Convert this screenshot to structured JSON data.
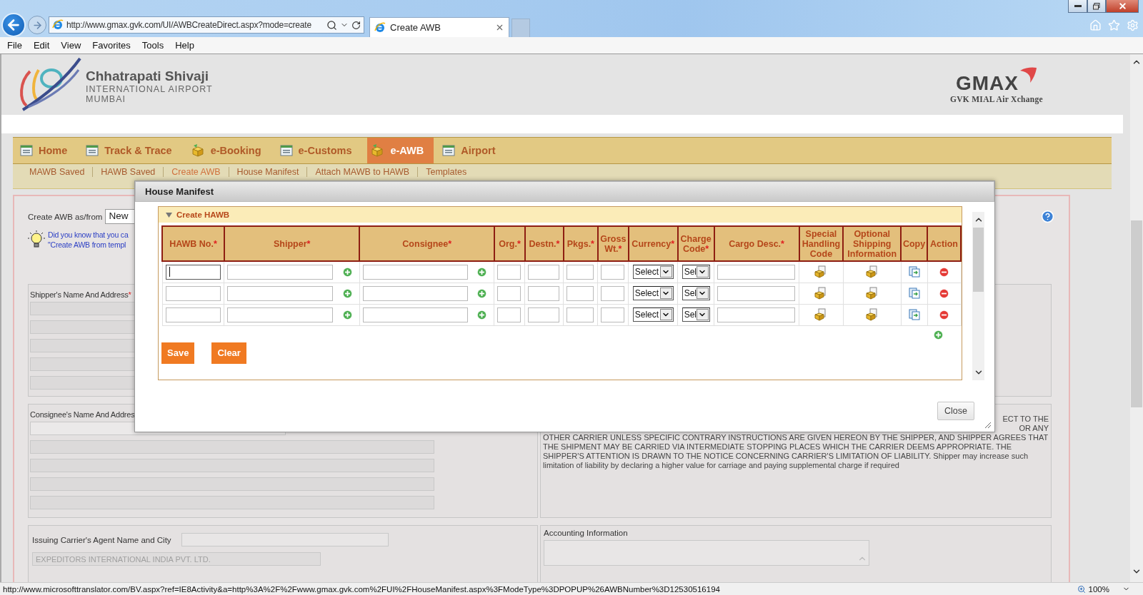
{
  "browser": {
    "address": "http://www.gmax.gvk.com/UI/AWBCreateDirect.aspx?mode=create",
    "tab": {
      "title": "Create AWB"
    },
    "menu": [
      "File",
      "Edit",
      "View",
      "Favorites",
      "Tools",
      "Help"
    ]
  },
  "header": {
    "airport_name": "Chhatrapati Shivaji",
    "airport_sub": "INTERNATIONAL AIRPORT",
    "city": "MUMBAI",
    "brand": "GMAX",
    "tagline": "GVK MIAL Air Xchange"
  },
  "nav": [
    {
      "label": "Home",
      "selected": false
    },
    {
      "label": "Track & Trace",
      "selected": false
    },
    {
      "label": "e-Booking",
      "selected": false
    },
    {
      "label": "e-Customs",
      "selected": false
    },
    {
      "label": "e-AWB",
      "selected": true
    },
    {
      "label": "Airport",
      "selected": false
    }
  ],
  "subnav": [
    {
      "label": "MAWB Saved",
      "selected": false
    },
    {
      "label": "HAWB Saved",
      "selected": false
    },
    {
      "label": "Create AWB",
      "selected": true
    },
    {
      "label": "House Manifest",
      "selected": false
    },
    {
      "label": "Attach MAWB to HAWB",
      "selected": false
    },
    {
      "label": "Templates",
      "selected": false
    }
  ],
  "form": {
    "create_from_label": "Create AWB as/from",
    "create_from_value": "New",
    "tip_lines": [
      "Did you know that you ca",
      "\"Create AWB from templ"
    ],
    "shipper_label": "Shipper's Name And Address",
    "shipper_mark": "*",
    "consignee_label": "Consignee's Name And Addres",
    "conditions_cut": [
      "ECT TO THE",
      "OR ANY"
    ],
    "conditions": "OTHER CARRIER UNLESS SPECIFIC CONTRARY INSTRUCTIONS ARE GIVEN HEREON BY THE SHIPPER, AND SHIPPER AGREES THAT THE SHIPMENT MAY BE CARRIED VIA INTERMEDIATE STOPPING PLACES WHICH THE CARRIER DEEMS APPROPRIATE. THE SHIPPER'S ATTENTION IS DRAWN TO THE NOTICE CONCERNING CARRIER'S LIMITATION OF LIABILITY. Shipper may increase such limitation of liability by declaring a higher value for carriage and paying supplemental charge if required",
    "carrier_label": "Issuing Carrier's Agent Name and City",
    "carrier_value": "EXPEDITORS INTERNATIONAL INDIA PVT. LTD.",
    "accounting_label": "Accounting Information"
  },
  "modal": {
    "title": "House Manifest",
    "section": {
      "title": "Create HAWB",
      "expanded": true
    },
    "columns": [
      {
        "label": "HAWB No.",
        "mark": "*",
        "kind": "text"
      },
      {
        "label": "Shipper",
        "mark": "*",
        "kind": "text_add"
      },
      {
        "label": "Consignee",
        "mark": "*",
        "kind": "text_add"
      },
      {
        "label": "Org.",
        "mark": "*",
        "kind": "text"
      },
      {
        "label": "Destn.",
        "mark": "*",
        "kind": "text"
      },
      {
        "label": "Pkgs.",
        "mark": "*",
        "kind": "text"
      },
      {
        "label": "Gross Wt.",
        "mark": "*",
        "kind": "text"
      },
      {
        "label": "Currency",
        "mark": "*",
        "kind": "select"
      },
      {
        "label": "Charge Code",
        "mark": "*",
        "kind": "select"
      },
      {
        "label": "Cargo Desc.",
        "mark": "*",
        "kind": "text"
      },
      {
        "label": "Special Handling Code",
        "kind": "special"
      },
      {
        "label": "Optional Shipping Information",
        "kind": "optional"
      },
      {
        "label": "Copy",
        "kind": "copy"
      },
      {
        "label": "Action",
        "kind": "remove"
      }
    ],
    "rows": [
      {
        "focused": true,
        "selects": [
          "Select",
          "Sel"
        ]
      },
      {
        "focused": false,
        "selects": [
          "Select",
          "Sel"
        ]
      },
      {
        "focused": false,
        "selects": [
          "Select",
          "Sel"
        ]
      }
    ],
    "buttons": [
      "Save",
      "Clear"
    ],
    "close": "Close"
  },
  "status_bar": {
    "url": "http://www.microsofttranslator.com/BV.aspx?ref=IE8Activity&a=http%3A%2F%2Fwww.gmax.gvk.com%2FUI%2FHouseManifest.aspx%3FModeType%3DPOPUP%26AWBNumber%3D12530516194",
    "zoom": "100%"
  }
}
